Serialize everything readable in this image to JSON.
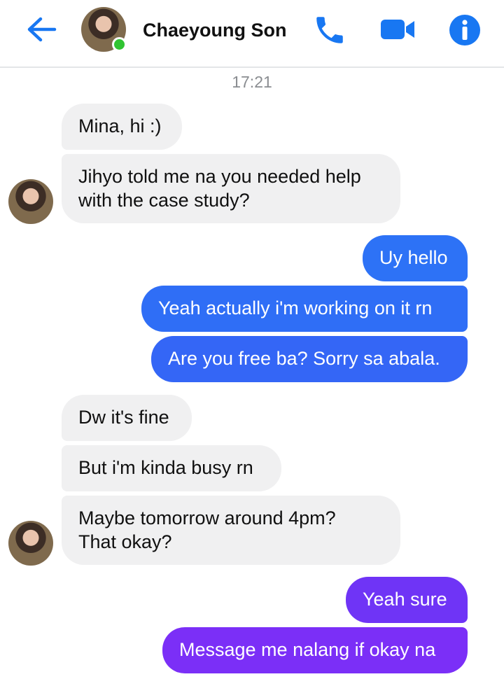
{
  "header": {
    "contact_name": "Chaeyoung Son",
    "online": true,
    "icons": {
      "back": "arrow-left-icon",
      "call": "phone-icon",
      "video": "video-camera-icon",
      "info": "info-icon"
    },
    "accent_color": "#1877f2"
  },
  "conversation": {
    "timestamp": "17:21",
    "messages": [
      {
        "sender": "them",
        "text": "Mina, hi :)"
      },
      {
        "sender": "them",
        "text": "Jihyo told me na you needed help",
        "text2": "with the case study?"
      },
      {
        "sender": "me",
        "text": "Uy hello"
      },
      {
        "sender": "me",
        "text": "Yeah actually i'm working on it rn"
      },
      {
        "sender": "me",
        "text": "Are you free ba? Sorry sa abala."
      },
      {
        "sender": "them",
        "text": "Dw it's fine"
      },
      {
        "sender": "them",
        "text": "But i'm kinda busy rn"
      },
      {
        "sender": "them",
        "text": "Maybe tomorrow around 4pm?",
        "text2": "That okay?"
      },
      {
        "sender": "me",
        "text": "Yeah sure"
      },
      {
        "sender": "me",
        "text": "Message me nalang if okay na"
      }
    ]
  },
  "colors": {
    "incoming_bubble": "#f0f0f1",
    "outgoing_blue": "#2f6ef6",
    "outgoing_purple": "#7b2ff7"
  }
}
